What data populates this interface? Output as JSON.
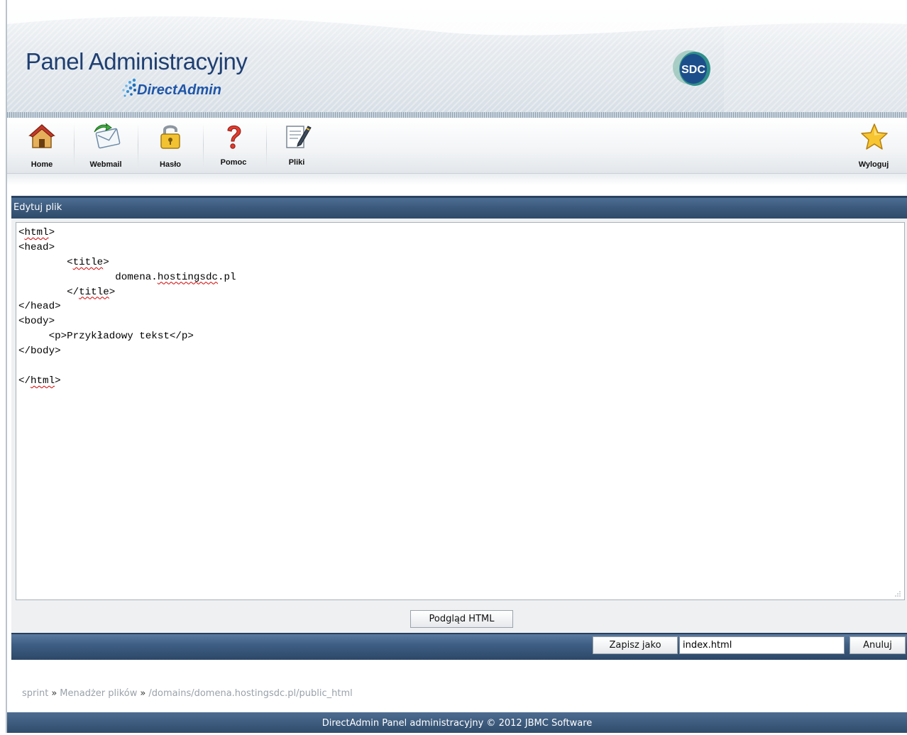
{
  "header": {
    "title": "Panel Administracyjny",
    "subtitle": "DirectAdmin",
    "sdc_logo_text": "SDC"
  },
  "toolbar": {
    "items": [
      {
        "label": "Home",
        "icon": "home-icon"
      },
      {
        "label": "Webmail",
        "icon": "webmail-icon"
      },
      {
        "label": "Hasło",
        "icon": "lock-icon"
      },
      {
        "label": "Pomoc",
        "icon": "help-icon"
      },
      {
        "label": "Pliki",
        "icon": "files-icon"
      }
    ],
    "logout_label": "Wyloguj"
  },
  "editor": {
    "panel_title": "Edytuj plik",
    "lines": [
      "<html>",
      "<head>",
      "        <title>",
      "                domena.hostingsdc.pl",
      "        </title>",
      "</head>",
      "<body>",
      "     <p>Przykładowy tekst</p>",
      "</body>",
      "",
      "</html>"
    ]
  },
  "actions": {
    "preview_label": "Podgląd HTML",
    "save_as_label": "Zapisz jako",
    "filename_value": "index.html",
    "cancel_label": "Anuluj"
  },
  "breadcrumb": {
    "items": [
      "sprint",
      "Menadżer plików",
      "/domains/domena.hostingsdc.pl/public_html"
    ],
    "separator": "»"
  },
  "footer": {
    "text": "DirectAdmin Panel administracyjny © 2012 JBMC Software"
  },
  "colors": {
    "title_blue": "#1f3f72",
    "panel_header": "#3c5a7d",
    "spellcheck_red": "#d40000"
  }
}
